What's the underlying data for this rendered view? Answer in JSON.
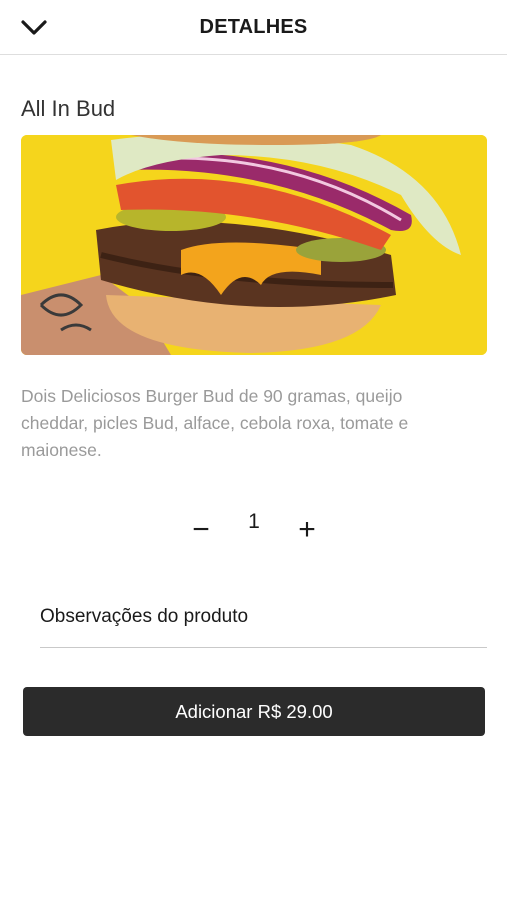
{
  "header": {
    "title": "DETALHES",
    "back_icon": "chevron-down-icon"
  },
  "product": {
    "name": "All In Bud",
    "image_alt": "burger photo",
    "description": "Dois Deliciosos Burger Bud de 90 gramas, queijo cheddar, picles Bud, alface, cebola roxa, tomate e maionese."
  },
  "quantity": {
    "minus_label": "−",
    "value": "1",
    "plus_label": "+"
  },
  "notes": {
    "placeholder": "Observações do produto"
  },
  "add_button": {
    "label": "Adicionar R$ 29.00"
  },
  "colors": {
    "button_bg": "#2b2b2b",
    "image_bg": "#f6d81c",
    "description_text": "#9a9a9a"
  }
}
